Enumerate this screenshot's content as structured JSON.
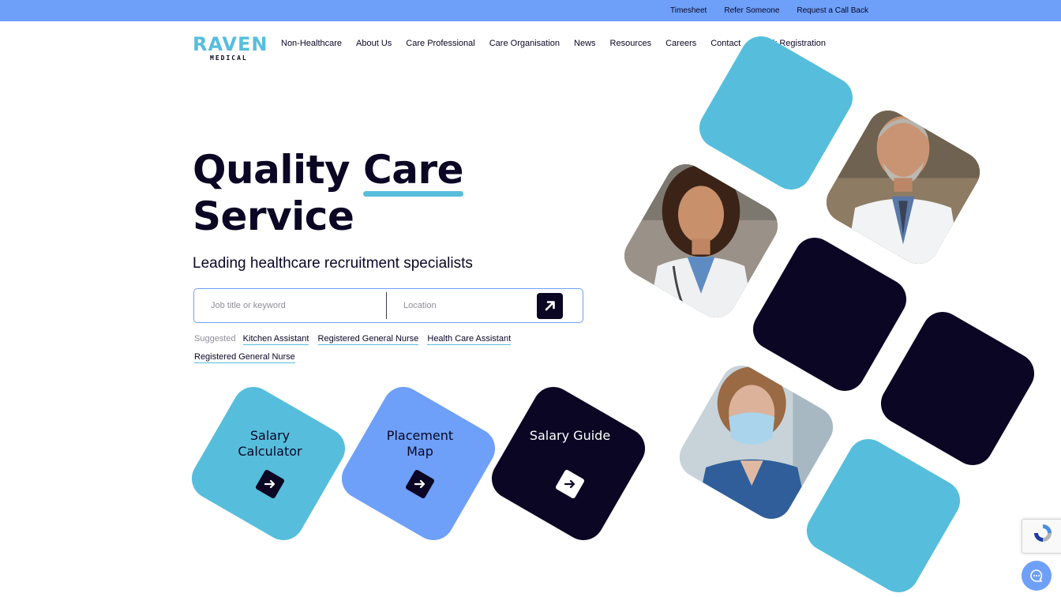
{
  "topbar": {
    "links": [
      "Timesheet",
      "Refer Someone",
      "Request a Call Back"
    ]
  },
  "logo": {
    "word": "RAVEN",
    "sub": "MEDICAL"
  },
  "nav": {
    "items": [
      "Non-Healthcare",
      "About Us",
      "Care Professional",
      "Care Organisation",
      "News",
      "Resources",
      "Careers",
      "Contact",
      "Quick Registration"
    ]
  },
  "hero": {
    "title_word1": "Quality",
    "title_word2": "Care",
    "title_line2": "Service",
    "subtitle": "Leading healthcare recruitment specialists"
  },
  "search": {
    "keyword_placeholder": "Job title or keyword",
    "keyword_value": "",
    "location_placeholder": "Location",
    "location_value": ""
  },
  "suggested": {
    "label": "Suggested",
    "items": [
      "Kitchen Assistant",
      "Registered General Nurse",
      "Health Care Assistant",
      "Registered General Nurse"
    ]
  },
  "cards": [
    {
      "line1": "Salary",
      "line2": "Calculator",
      "color": "#56bedc"
    },
    {
      "line1": "Placement",
      "line2": "Map",
      "color": "#6ea0f9"
    },
    {
      "line1": "Salary Guide",
      "line2": "",
      "color": "#0a0624"
    }
  ],
  "colors": {
    "accent_blue": "#56bedc",
    "periwinkle": "#6ea0f9",
    "navy": "#0a0624"
  },
  "icons": {
    "search_submit": "arrow-up-right-icon",
    "card_arrow": "arrow-right-icon",
    "chat": "chat-bubble-icon",
    "recaptcha": "recaptcha-icon"
  }
}
